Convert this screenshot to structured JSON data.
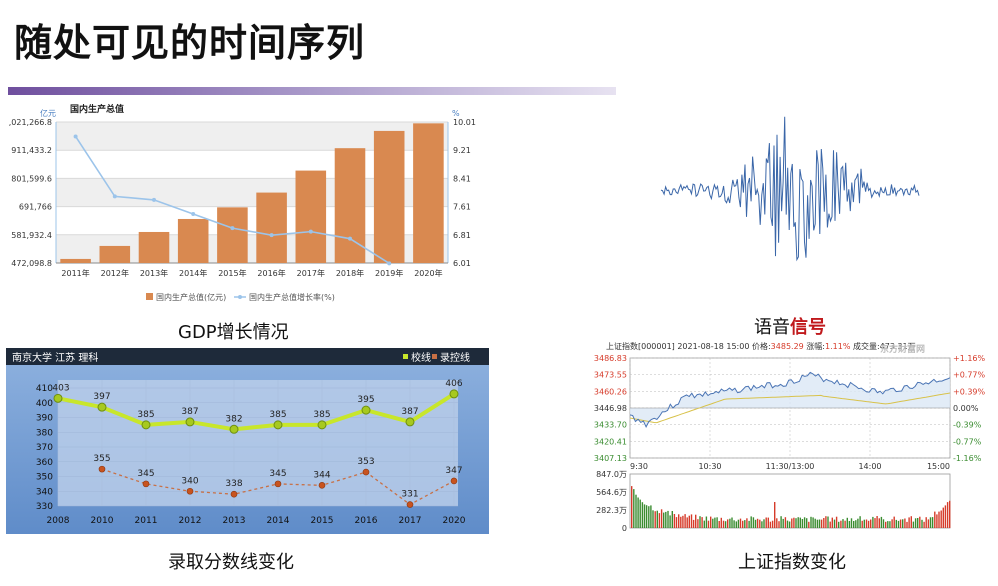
{
  "slide": {
    "title": "随处可见的时间序列",
    "captions": {
      "gdp": "GDP增长情况",
      "speech_prefix": "语音",
      "speech_highlight": "信号",
      "score": "录取分数线变化",
      "stock": "上证指数变化"
    }
  },
  "chart_data": [
    {
      "type": "bar",
      "title": "国内生产总值",
      "ylabel_left": "亿元",
      "ylabel_right": "%",
      "categories": [
        "2011年",
        "2012年",
        "2013年",
        "2014年",
        "2015年",
        "2016年",
        "2017年",
        "2018年",
        "2019年",
        "2020年"
      ],
      "y_ticks_left": [
        "1,021,266.8",
        "911,433.2",
        "801,599.6",
        "691,766",
        "581,932.4",
        "472,098.8"
      ],
      "y_ticks_right": [
        "10.01",
        "9.21",
        "8.41",
        "7.61",
        "6.81",
        "6.01"
      ],
      "ylim_left": [
        472098.8,
        1021266.8
      ],
      "ylim_right": [
        6.01,
        10.01
      ],
      "series": [
        {
          "name": "国内生产总值(亿元)",
          "kind": "bar",
          "color": "#d98950",
          "values": [
            487940,
            538580,
            592963,
            643563,
            688858,
            746395,
            832036,
            919281,
            986515,
            1015986
          ]
        },
        {
          "name": "国内生产总值增长率(%)",
          "kind": "line",
          "color": "#9cc4ea",
          "values": [
            9.6,
            7.9,
            7.8,
            7.4,
            7.0,
            6.8,
            6.9,
            6.7,
            6.0,
            null
          ]
        }
      ],
      "grid": true,
      "legend": "bottom"
    },
    {
      "type": "line",
      "title": "",
      "header_left": "南京大学  江苏  理科",
      "legend_items": [
        "校线",
        "录控线"
      ],
      "categories": [
        "2008",
        "2010",
        "2011",
        "2012",
        "2013",
        "2014",
        "2015",
        "2016",
        "2017",
        "2020"
      ],
      "y_ticks": [
        "410",
        "400",
        "390",
        "380",
        "370",
        "360",
        "350",
        "340",
        "330"
      ],
      "ylim": [
        330,
        410
      ],
      "series": [
        {
          "name": "校线",
          "color": "#c8e62b",
          "values": [
            403,
            397,
            385,
            387,
            382,
            385,
            385,
            395,
            387,
            406
          ]
        },
        {
          "name": "录控线",
          "color": "#c87045",
          "values": [
            null,
            355,
            345,
            340,
            338,
            345,
            344,
            353,
            331,
            347
          ]
        }
      ],
      "grid": true,
      "legend": "top-right"
    },
    {
      "type": "line",
      "header": {
        "name": "上证指数[000001]",
        "date": "2021-08-18 15:00",
        "price_label": "价格:",
        "price": "3485.29",
        "change_label": "涨幅:",
        "change": "1.11%",
        "volume_label": "成交量:",
        "volume": "473.31万"
      },
      "watermark": "东方财富网",
      "x_ticks": [
        "9:30",
        "10:30",
        "11:30/13:00",
        "14:00",
        "15:00"
      ],
      "y_ticks_left": [
        "3486.83",
        "3473.55",
        "3460.26",
        "3446.98",
        "3433.70",
        "3420.41",
        "3407.13"
      ],
      "y_ticks_right": [
        "+1.16%",
        "+0.77%",
        "+0.39%",
        "0.00%",
        "-0.39%",
        "-0.77%",
        "-1.16%"
      ],
      "volume_ticks": [
        "847.0万",
        "564.6万",
        "282.3万",
        "0"
      ],
      "colors": {
        "up": "#d63b2a",
        "down": "#3a8c30",
        "price": "#4a74b4",
        "avg": "#d8c24a"
      }
    }
  ]
}
